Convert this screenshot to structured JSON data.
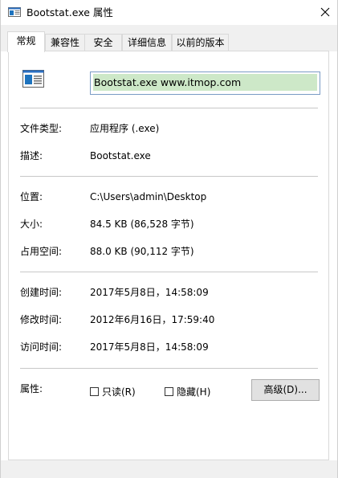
{
  "window": {
    "title": "Bootstat.exe 属性"
  },
  "tabs": [
    {
      "label": "常规",
      "active": true
    },
    {
      "label": "兼容性",
      "active": false
    },
    {
      "label": "安全",
      "active": false
    },
    {
      "label": "详细信息",
      "active": false
    },
    {
      "label": "以前的版本",
      "active": false
    }
  ],
  "general": {
    "file_name": "Bootstat.exe www.itmop.com",
    "type_label": "文件类型:",
    "type_value": "应用程序 (.exe)",
    "desc_label": "描述:",
    "desc_value": "Bootstat.exe",
    "location_label": "位置:",
    "location_value": "C:\\Users\\admin\\Desktop",
    "size_label": "大小:",
    "size_value": "84.5 KB (86,528 字节)",
    "disk_label": "占用空间:",
    "disk_value": "88.0 KB (90,112 字节)",
    "created_label": "创建时间:",
    "created_value": "2017年5月8日，14:58:09",
    "modified_label": "修改时间:",
    "modified_value": "2012年6月16日，17:59:40",
    "accessed_label": "访问时间:",
    "accessed_value": "2017年5月8日，14:58:09",
    "attr_label": "属性:",
    "readonly_label": "只读(R)",
    "readonly_checked": false,
    "hidden_label": "隐藏(H)",
    "hidden_checked": false,
    "advanced_label": "高级(D)..."
  },
  "colors": {
    "selection": "#cde8c8",
    "input_border": "#7a9cc5",
    "accent": "#1e73be"
  }
}
